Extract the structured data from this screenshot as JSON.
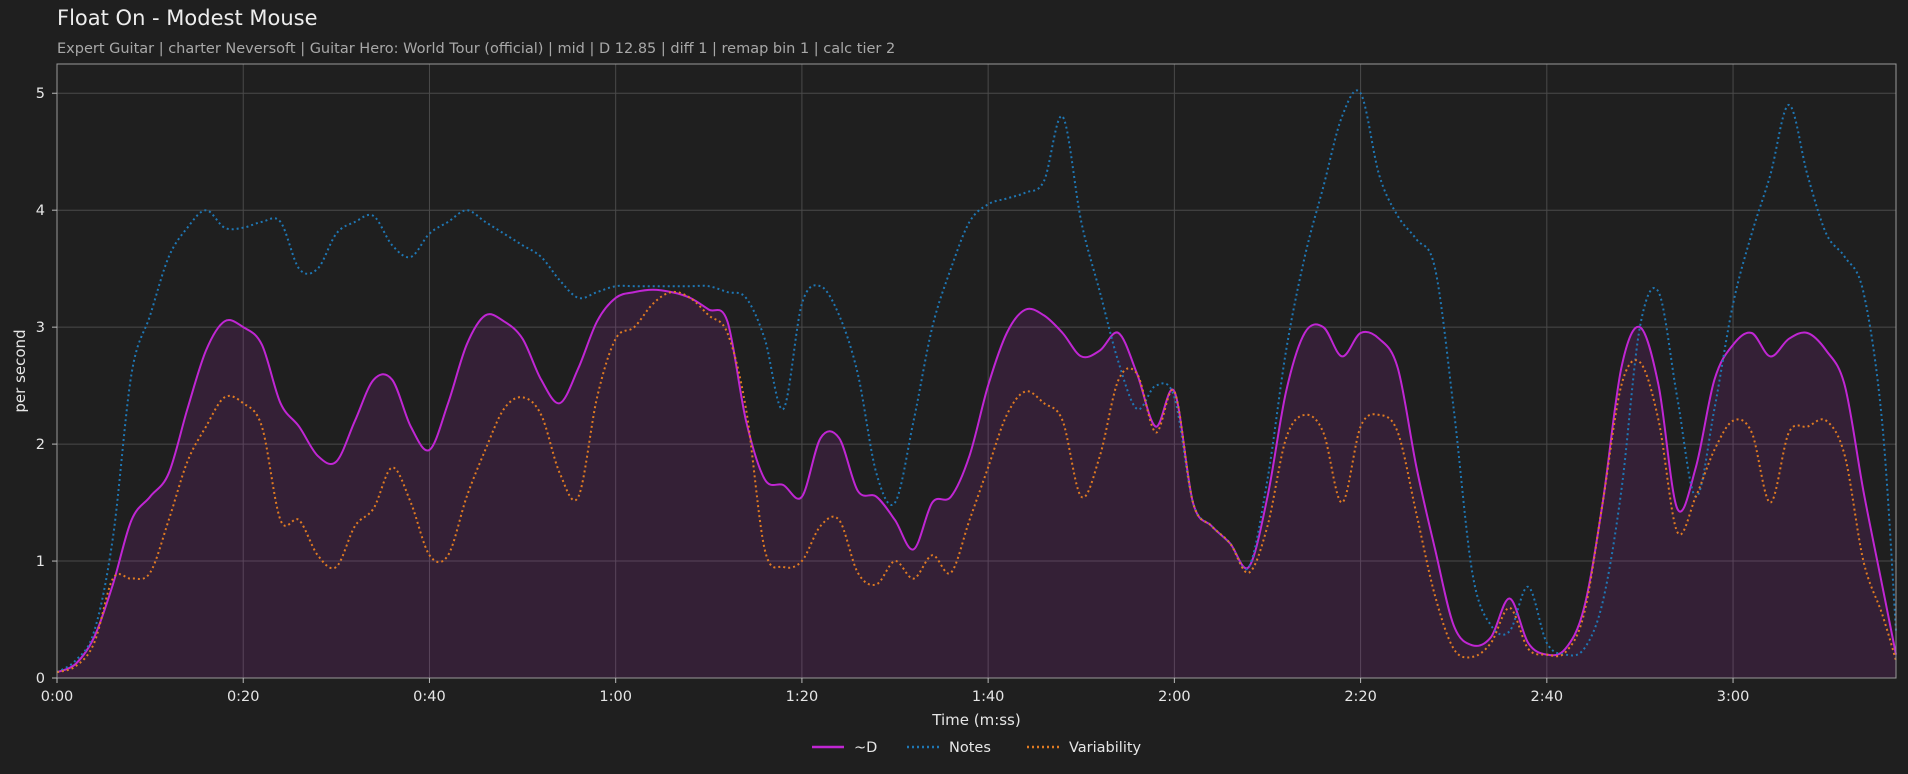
{
  "chart_data": {
    "type": "line",
    "title": "Float On - Modest Mouse",
    "subtitle": "Expert Guitar  |  charter Neversoft  |  Guitar Hero: World Tour (official)  |  mid  |  D 12.85  |  diff 1  |  remap bin 1  |  calc tier 2",
    "xlabel": "Time (m:ss)",
    "ylabel": "per second",
    "xlim": [
      0,
      197.5
    ],
    "ylim": [
      0,
      5.25
    ],
    "grid": true,
    "legend_position": "bottom-center",
    "x_ticks": [
      0,
      20,
      40,
      60,
      80,
      100,
      120,
      140,
      160,
      180
    ],
    "x_tick_labels": [
      "0:00",
      "0:20",
      "0:40",
      "1:00",
      "1:20",
      "1:40",
      "2:00",
      "2:20",
      "2:40",
      "3:00"
    ],
    "y_ticks": [
      0,
      1,
      2,
      3,
      4,
      5
    ],
    "y_tick_labels": [
      "0",
      "1",
      "2",
      "3",
      "4",
      "5"
    ],
    "series": [
      {
        "name": "~D",
        "color": "#c026d3",
        "style": "solid",
        "filled": true,
        "x": [
          0,
          2,
          4,
          6,
          8,
          10,
          12,
          14,
          16,
          18,
          20,
          22,
          24,
          26,
          28,
          30,
          32,
          34,
          36,
          38,
          40,
          42,
          44,
          46,
          48,
          50,
          52,
          54,
          56,
          58,
          60,
          62,
          64,
          66,
          68,
          70,
          72,
          74,
          76,
          78,
          80,
          82,
          84,
          86,
          88,
          90,
          92,
          94,
          96,
          98,
          100,
          102,
          104,
          106,
          108,
          110,
          112,
          114,
          116,
          118,
          120,
          122,
          124,
          126,
          128,
          130,
          132,
          134,
          136,
          138,
          140,
          142,
          144,
          146,
          148,
          150,
          152,
          154,
          156,
          158,
          160,
          162,
          164,
          166,
          168,
          170,
          172,
          174,
          176,
          178,
          180,
          182,
          184,
          186,
          188,
          190,
          192,
          194,
          196,
          197.5
        ],
        "y": [
          0.05,
          0.12,
          0.35,
          0.8,
          1.35,
          1.55,
          1.75,
          2.3,
          2.8,
          3.05,
          3.0,
          2.85,
          2.35,
          2.15,
          1.9,
          1.85,
          2.2,
          2.55,
          2.55,
          2.15,
          1.95,
          2.35,
          2.85,
          3.1,
          3.05,
          2.9,
          2.55,
          2.35,
          2.65,
          3.05,
          3.25,
          3.3,
          3.32,
          3.3,
          3.25,
          3.15,
          3.05,
          2.2,
          1.7,
          1.65,
          1.55,
          2.05,
          2.05,
          1.6,
          1.55,
          1.35,
          1.1,
          1.5,
          1.55,
          1.9,
          2.5,
          2.95,
          3.15,
          3.1,
          2.95,
          2.75,
          2.8,
          2.95,
          2.6,
          2.15,
          2.45,
          1.5,
          1.3,
          1.15,
          0.95,
          1.55,
          2.45,
          2.95,
          3.0,
          2.75,
          2.95,
          2.9,
          2.65,
          1.8,
          1.1,
          0.45,
          0.28,
          0.35,
          0.68,
          0.3,
          0.2,
          0.25,
          0.6,
          1.5,
          2.65,
          3.0,
          2.5,
          1.45,
          1.8,
          2.55,
          2.85,
          2.95,
          2.75,
          2.9,
          2.95,
          2.8,
          2.5,
          1.6,
          0.8,
          0.2
        ]
      },
      {
        "name": "Notes",
        "color": "#1f77b4",
        "style": "dotted",
        "filled": false,
        "x": [
          0,
          2,
          4,
          6,
          8,
          10,
          12,
          14,
          16,
          18,
          20,
          22,
          24,
          26,
          28,
          30,
          32,
          34,
          36,
          38,
          40,
          42,
          44,
          46,
          48,
          50,
          52,
          54,
          56,
          58,
          60,
          62,
          64,
          66,
          68,
          70,
          72,
          74,
          76,
          78,
          80,
          82,
          84,
          86,
          88,
          90,
          92,
          94,
          96,
          98,
          100,
          102,
          104,
          106,
          108,
          110,
          112,
          114,
          116,
          118,
          120,
          122,
          124,
          126,
          128,
          130,
          132,
          134,
          136,
          138,
          140,
          142,
          144,
          146,
          148,
          150,
          152,
          154,
          156,
          158,
          160,
          162,
          164,
          166,
          168,
          170,
          172,
          174,
          176,
          178,
          180,
          182,
          184,
          186,
          188,
          190,
          192,
          194,
          196,
          197.5
        ],
        "y": [
          0.05,
          0.15,
          0.4,
          1.2,
          2.6,
          3.1,
          3.6,
          3.85,
          4.0,
          3.85,
          3.85,
          3.9,
          3.9,
          3.5,
          3.5,
          3.8,
          3.9,
          3.95,
          3.7,
          3.6,
          3.8,
          3.9,
          4.0,
          3.9,
          3.8,
          3.7,
          3.6,
          3.4,
          3.25,
          3.3,
          3.35,
          3.35,
          3.35,
          3.35,
          3.35,
          3.35,
          3.3,
          3.25,
          2.9,
          2.3,
          3.2,
          3.35,
          3.1,
          2.6,
          1.75,
          1.5,
          2.2,
          3.0,
          3.5,
          3.9,
          4.05,
          4.1,
          4.15,
          4.25,
          4.8,
          3.9,
          3.3,
          2.7,
          2.3,
          2.5,
          2.4,
          1.5,
          1.3,
          1.15,
          0.95,
          1.7,
          2.8,
          3.6,
          4.2,
          4.8,
          5.0,
          4.3,
          3.95,
          3.75,
          3.5,
          2.3,
          0.9,
          0.45,
          0.4,
          0.78,
          0.3,
          0.2,
          0.25,
          0.65,
          1.6,
          3.0,
          3.3,
          2.4,
          1.55,
          2.3,
          3.2,
          3.8,
          4.3,
          4.9,
          4.3,
          3.8,
          3.6,
          3.3,
          2.2,
          0.4
        ]
      },
      {
        "name": "Variability",
        "color": "#e07b22",
        "style": "dotted",
        "filled": false,
        "x": [
          0,
          2,
          4,
          6,
          8,
          10,
          12,
          14,
          16,
          18,
          20,
          22,
          24,
          26,
          28,
          30,
          32,
          34,
          36,
          38,
          40,
          42,
          44,
          46,
          48,
          50,
          52,
          54,
          56,
          58,
          60,
          62,
          64,
          66,
          68,
          70,
          72,
          74,
          76,
          78,
          80,
          82,
          84,
          86,
          88,
          90,
          92,
          94,
          96,
          98,
          100,
          102,
          104,
          106,
          108,
          110,
          112,
          114,
          116,
          118,
          120,
          122,
          124,
          126,
          128,
          130,
          132,
          134,
          136,
          138,
          140,
          142,
          144,
          146,
          148,
          150,
          152,
          154,
          156,
          158,
          160,
          162,
          164,
          166,
          168,
          170,
          172,
          174,
          176,
          178,
          180,
          182,
          184,
          186,
          188,
          190,
          192,
          194,
          196,
          197.5
        ],
        "y": [
          0.05,
          0.1,
          0.3,
          0.85,
          0.85,
          0.9,
          1.35,
          1.85,
          2.15,
          2.4,
          2.35,
          2.15,
          1.35,
          1.35,
          1.05,
          0.95,
          1.3,
          1.45,
          1.8,
          1.5,
          1.05,
          1.05,
          1.55,
          1.95,
          2.3,
          2.4,
          2.25,
          1.75,
          1.55,
          2.4,
          2.9,
          3.0,
          3.2,
          3.3,
          3.25,
          3.1,
          2.95,
          2.3,
          1.1,
          0.95,
          1.0,
          1.3,
          1.35,
          0.9,
          0.8,
          1.0,
          0.85,
          1.05,
          0.9,
          1.35,
          1.8,
          2.25,
          2.45,
          2.35,
          2.2,
          1.55,
          1.9,
          2.55,
          2.6,
          2.1,
          2.45,
          1.5,
          1.3,
          1.15,
          0.9,
          1.3,
          2.05,
          2.25,
          2.1,
          1.5,
          2.15,
          2.25,
          2.1,
          1.4,
          0.7,
          0.25,
          0.18,
          0.3,
          0.6,
          0.25,
          0.2,
          0.22,
          0.55,
          1.5,
          2.5,
          2.7,
          2.2,
          1.25,
          1.55,
          1.95,
          2.2,
          2.1,
          1.5,
          2.1,
          2.15,
          2.2,
          1.9,
          1.0,
          0.55,
          0.15
        ]
      }
    ]
  }
}
